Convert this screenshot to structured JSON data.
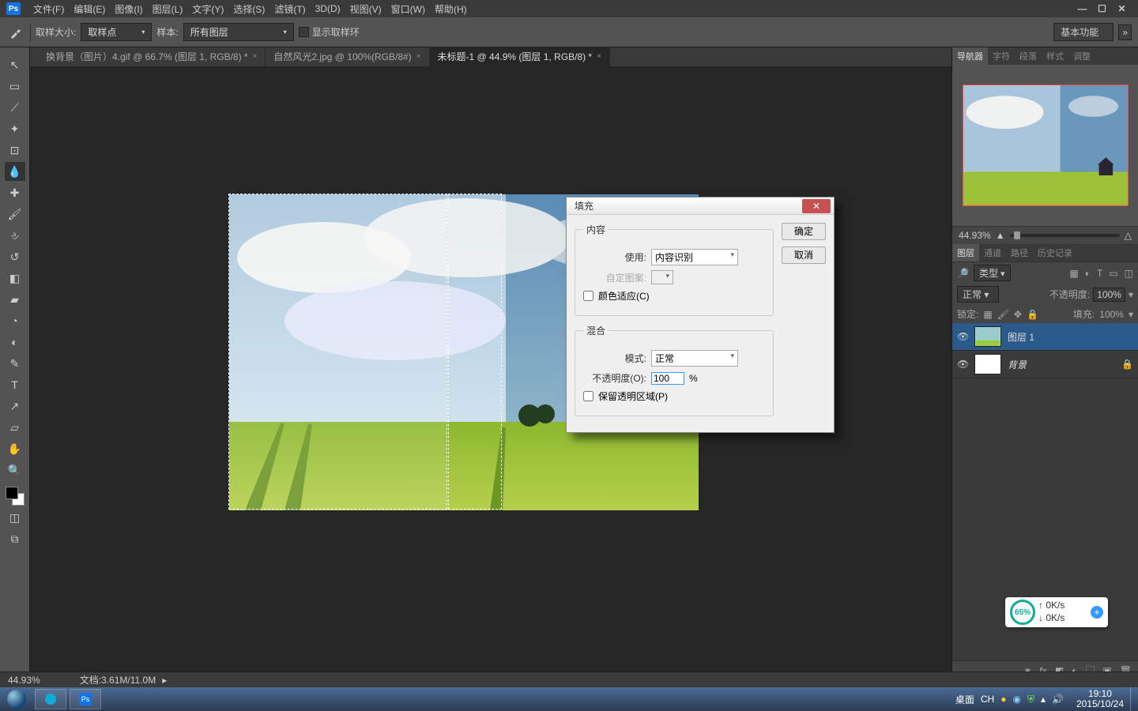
{
  "title_bar": {
    "ps_label": "Ps",
    "menus": [
      "文件(F)",
      "编辑(E)",
      "图像(I)",
      "图层(L)",
      "文字(Y)",
      "选择(S)",
      "滤镜(T)",
      "3D(D)",
      "视图(V)",
      "窗口(W)",
      "帮助(H)"
    ],
    "win_buttons": [
      "—",
      "☐",
      "✕"
    ]
  },
  "option_bar": {
    "sample_size_label": "取样大小:",
    "sample_size_value": "取样点",
    "sample_label": "样本:",
    "sample_value": "所有图层",
    "show_ring_label": "显示取样环",
    "right_label": "基本功能"
  },
  "tabs": [
    {
      "label": "换背景（图片）4.gif @ 66.7% (图层 1, RGB/8) *",
      "active": false
    },
    {
      "label": "自然风光2.jpg @ 100%(RGB/8#)",
      "active": false
    },
    {
      "label": "未标题-1 @ 44.9% (图层 1, RGB/8) *",
      "active": true
    }
  ],
  "tools": [
    {
      "name": "move",
      "g": "↖"
    },
    {
      "name": "marquee",
      "g": "▭"
    },
    {
      "name": "lasso",
      "g": "⟋"
    },
    {
      "name": "wand",
      "g": "✦"
    },
    {
      "name": "crop",
      "g": "⊡"
    },
    {
      "name": "eyedropper",
      "g": "💧",
      "active": true
    },
    {
      "name": "spot",
      "g": "✚"
    },
    {
      "name": "brush",
      "g": "🖌"
    },
    {
      "name": "stamp",
      "g": "⎀"
    },
    {
      "name": "history",
      "g": "↺"
    },
    {
      "name": "eraser",
      "g": "◧"
    },
    {
      "name": "gradient",
      "g": "▰"
    },
    {
      "name": "blur",
      "g": "◔"
    },
    {
      "name": "dodge",
      "g": "◐"
    },
    {
      "name": "pen",
      "g": "✎"
    },
    {
      "name": "type",
      "g": "T"
    },
    {
      "name": "path",
      "g": "↗"
    },
    {
      "name": "shape",
      "g": "▱"
    },
    {
      "name": "hand",
      "g": "✋"
    },
    {
      "name": "zoom",
      "g": "🔍"
    }
  ],
  "dialog": {
    "title": "填充",
    "ok": "确定",
    "cancel": "取消",
    "content_legend": "内容",
    "use_label": "使用:",
    "use_value": "内容识别",
    "custom_pattern_label": "自定图案:",
    "color_adapt_label": "颜色适应(C)",
    "blend_legend": "混合",
    "mode_label": "模式:",
    "mode_value": "正常",
    "opacity_label": "不透明度(O):",
    "opacity_value": "100",
    "opacity_pct": "%",
    "preserve_alpha_label": "保留透明区域(P)"
  },
  "panels": {
    "nav_tabs": [
      "导航器",
      "字符",
      "段落",
      "样式",
      "调整"
    ],
    "zoom_pct": "44.93%",
    "layer_tabs": [
      "图层",
      "通道",
      "路径",
      "历史记录"
    ],
    "kind_value": "类型",
    "blend_mode": "正常",
    "opacity_label": "不透明度:",
    "opacity_value": "100%",
    "lock_label": "锁定:",
    "fill_label": "填充:",
    "fill_value": "100%",
    "layers": [
      {
        "name": "图层 1",
        "selected": true,
        "kind": "image"
      },
      {
        "name": "背景",
        "selected": false,
        "kind": "white",
        "locked": true
      }
    ]
  },
  "status_bar": {
    "zoom": "44.93%",
    "doc": "文档:3.61M/11.0M"
  },
  "taskbar": {
    "desktop_label": "桌面",
    "tray": {
      "ime": "CH",
      "net_up": "0K/s",
      "net_dn": "0K/s",
      "battery_pct": "65%",
      "time": "19:10",
      "date": "2015/10/24"
    }
  }
}
